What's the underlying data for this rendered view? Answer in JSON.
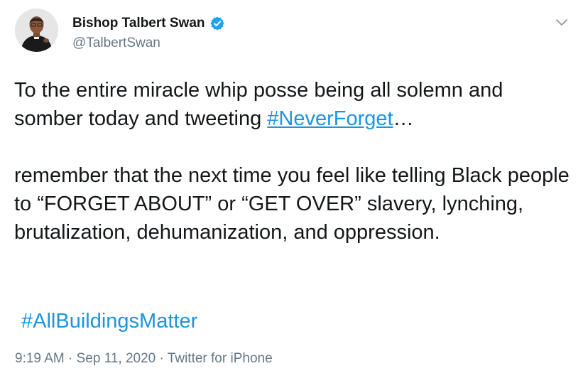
{
  "author": {
    "display_name": "Bishop Talbert Swan",
    "handle": "@TalbertSwan",
    "verified": true,
    "avatar_icon": "avatar-photo"
  },
  "menu": {
    "icon": "chevron-down-icon"
  },
  "tweet": {
    "para1_text": "To the entire miracle whip posse being all solemn and somber today and tweeting ",
    "para1_hashtag": "#NeverForget",
    "para1_suffix": "…",
    "para2_text": "remember that the next time you feel like telling Black people to “FORGET ABOUT” or “GET OVER” slavery, lynching, brutalization, dehumanization, and oppression.",
    "hashtag2": "#AllBuildingsMatter"
  },
  "meta": {
    "time": "9:19 AM",
    "separator": "·",
    "date": "Sep 11, 2020",
    "source": "Twitter for iPhone"
  },
  "colors": {
    "link": "#1b95e0",
    "secondary_text": "#657786",
    "primary_text": "#14171a",
    "verified_badge": "#1da1f2"
  }
}
